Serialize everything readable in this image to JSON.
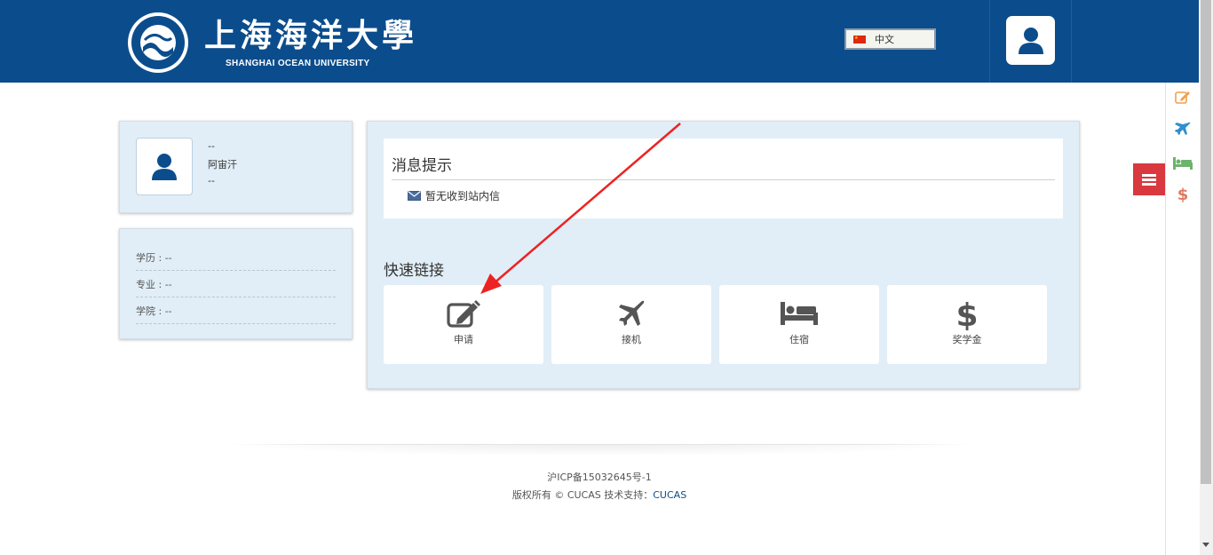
{
  "header": {
    "logo_cn": "上海海洋大學",
    "logo_en": "SHANGHAI OCEAN UNIVERSITY",
    "language": "中文",
    "brand_color": "#0b4d8c"
  },
  "profile": {
    "line1": "--",
    "name": "阿宙汗",
    "line3": "--"
  },
  "info": [
    {
      "label": "学历 : --"
    },
    {
      "label": "专业 : --"
    },
    {
      "label": "学院 : --"
    }
  ],
  "messages": {
    "title": "消息提示",
    "empty": "暂无收到站内信"
  },
  "quick_links": {
    "title": "快速链接",
    "items": [
      {
        "label": "申请",
        "icon": "edit-icon"
      },
      {
        "label": "接机",
        "icon": "plane-icon"
      },
      {
        "label": "住宿",
        "icon": "bed-icon"
      },
      {
        "label": "奖学金",
        "icon": "dollar-icon"
      }
    ]
  },
  "side_rail": {
    "icons": [
      "edit-icon",
      "plane-icon",
      "bed-icon",
      "dollar-icon"
    ],
    "colors": [
      "#f0a050",
      "#2f8fd0",
      "#6db36d",
      "#e07a5f"
    ],
    "menu_color": "#d9383f"
  },
  "footer": {
    "icp": "沪ICP备15032645号-1",
    "copyright": "版权所有 © CUCAS 技术支持：",
    "link": "CUCAS"
  }
}
